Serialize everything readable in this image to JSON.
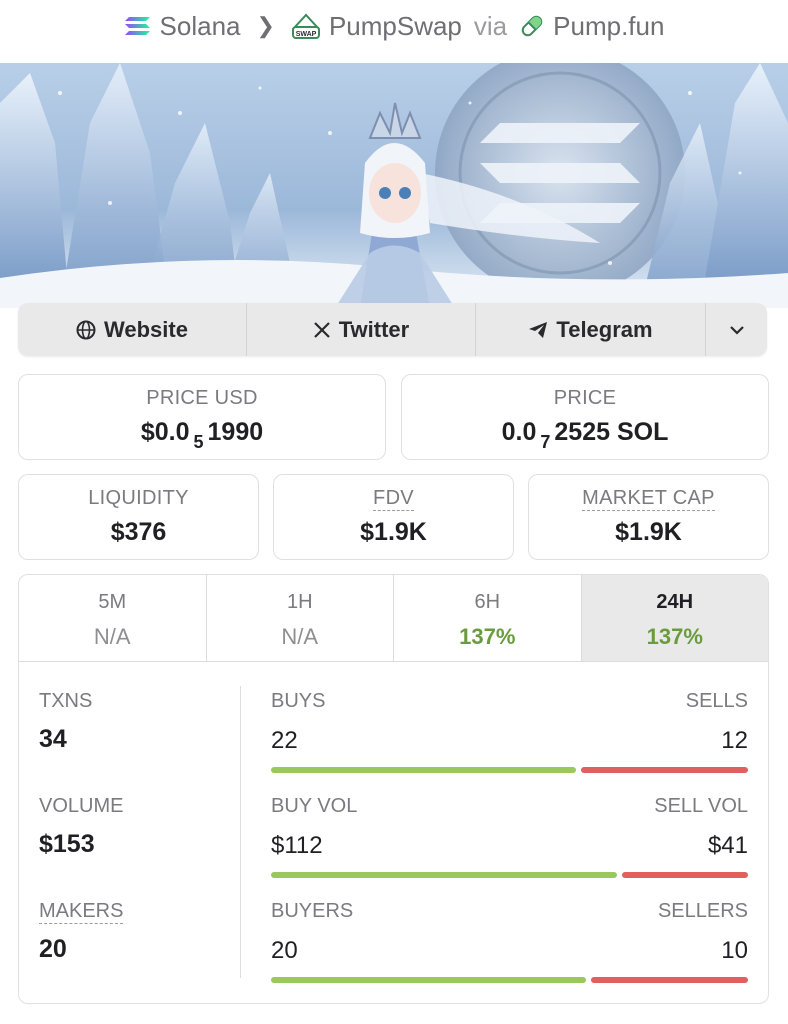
{
  "breadcrumb": {
    "chain": "Solana",
    "dex": "PumpSwap",
    "via": "via",
    "launchpad": "Pump.fun"
  },
  "links": {
    "website": "Website",
    "twitter": "Twitter",
    "telegram": "Telegram"
  },
  "price_usd": {
    "label": "PRICE USD",
    "prefix": "$0.0",
    "zeros": "5",
    "digits": "1990"
  },
  "price_native": {
    "label": "PRICE",
    "prefix": "0.0",
    "zeros": "7",
    "digits": "2525 SOL"
  },
  "liquidity": {
    "label": "LIQUIDITY",
    "value": "$376"
  },
  "fdv": {
    "label": "FDV",
    "value": "$1.9K"
  },
  "market_cap": {
    "label": "MARKET CAP",
    "value": "$1.9K"
  },
  "timeframes": [
    {
      "label": "5M",
      "value": "N/A"
    },
    {
      "label": "1H",
      "value": "N/A"
    },
    {
      "label": "6H",
      "value": "137%"
    },
    {
      "label": "24H",
      "value": "137%"
    }
  ],
  "active_timeframe": "24H",
  "stats": {
    "txns": {
      "label": "TXNS",
      "value": "34"
    },
    "volume": {
      "label": "VOLUME",
      "value": "$153"
    },
    "makers": {
      "label": "MAKERS",
      "value": "20"
    },
    "buys": {
      "label": "BUYS",
      "value": "22"
    },
    "sells": {
      "label": "SELLS",
      "value": "12"
    },
    "buy_vol": {
      "label": "BUY VOL",
      "value": "$112"
    },
    "sell_vol": {
      "label": "SELL VOL",
      "value": "$41"
    },
    "buyers": {
      "label": "BUYERS",
      "value": "20"
    },
    "sellers": {
      "label": "SELLERS",
      "value": "10"
    }
  },
  "ratios": {
    "buys_fraction": 0.647,
    "buy_vol_fraction": 0.732,
    "buyers_fraction": 0.667
  },
  "colors": {
    "positive": "#6a9c3d",
    "buy_bar": "#9ac85a",
    "sell_bar": "#e06060"
  },
  "icons": [
    "solana-icon",
    "chevron-right-icon",
    "pumpswap-icon",
    "pill-icon",
    "globe-icon",
    "x-icon",
    "telegram-icon",
    "chevron-down-icon"
  ]
}
